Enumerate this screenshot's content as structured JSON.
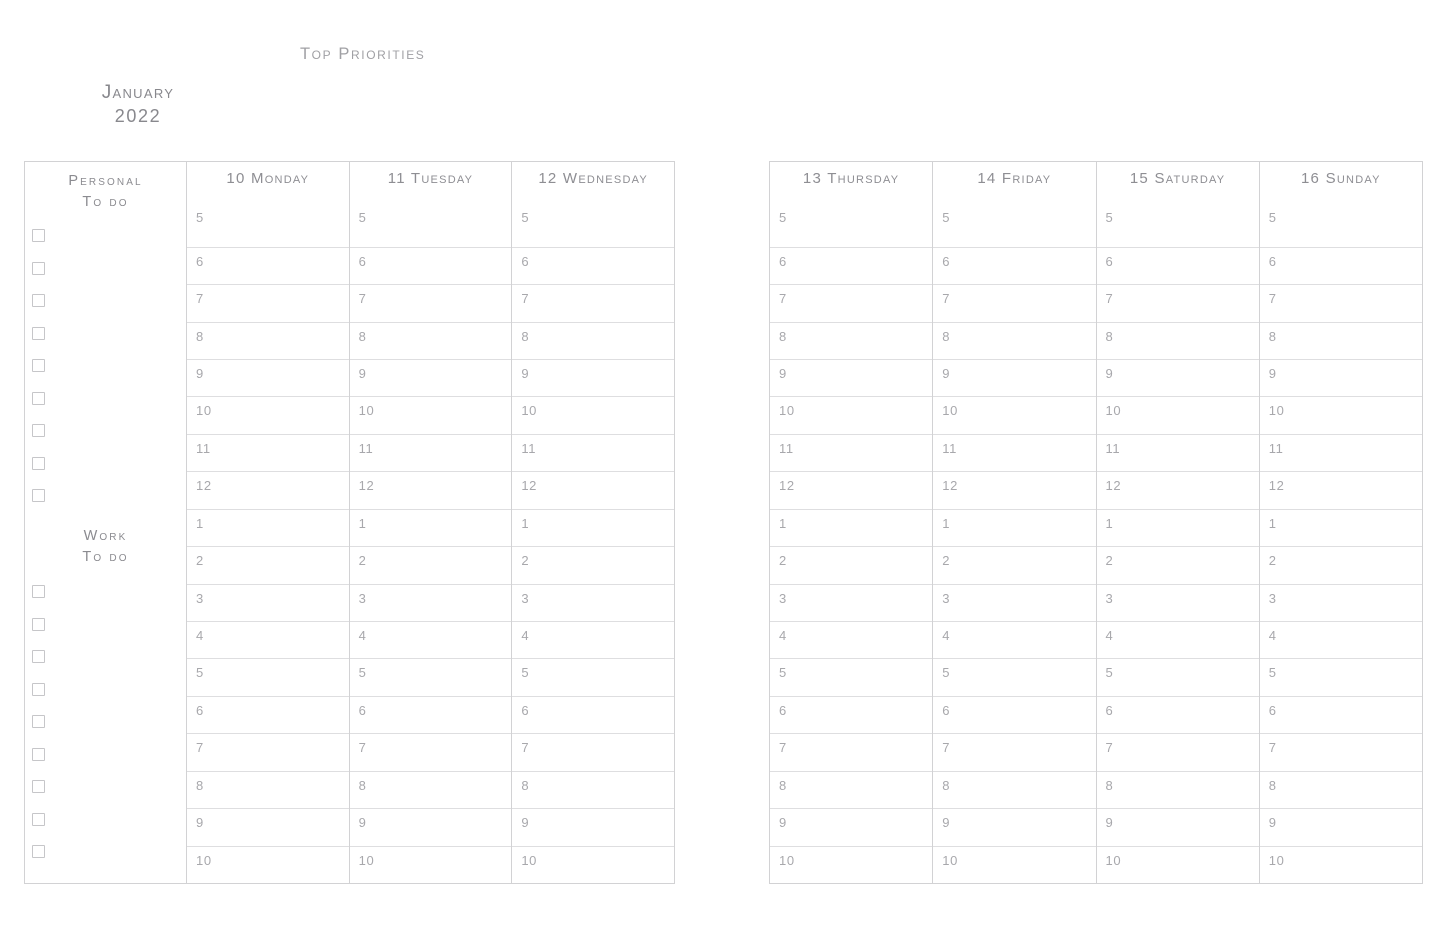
{
  "header": {
    "top_priorities": "Top Priorities",
    "month": "January",
    "year": "2022"
  },
  "todo": {
    "personal": {
      "line1": "Personal",
      "line2": "To do",
      "checkbox_count": 9
    },
    "work": {
      "line1": "Work",
      "line2": "To do",
      "checkbox_count": 9
    }
  },
  "hours": [
    "5",
    "6",
    "7",
    "8",
    "9",
    "10",
    "11",
    "12",
    "1",
    "2",
    "3",
    "4",
    "5",
    "6",
    "7",
    "8",
    "9",
    "10"
  ],
  "left_page": {
    "days": [
      {
        "label": "10 Monday"
      },
      {
        "label": "11 Tuesday"
      },
      {
        "label": "12 Wednesday"
      }
    ]
  },
  "right_page": {
    "days": [
      {
        "label": "13 Thursday"
      },
      {
        "label": "14 Friday"
      },
      {
        "label": "15 Saturday"
      },
      {
        "label": "16 Sunday"
      }
    ]
  },
  "colors": {
    "border": "#d2d2d4",
    "row_line": "#dedee0",
    "heading_text": "#8e8e93",
    "hour_text": "#a8a8ac",
    "checkbox_border": "#c6c6c9",
    "background": "#ffffff"
  }
}
